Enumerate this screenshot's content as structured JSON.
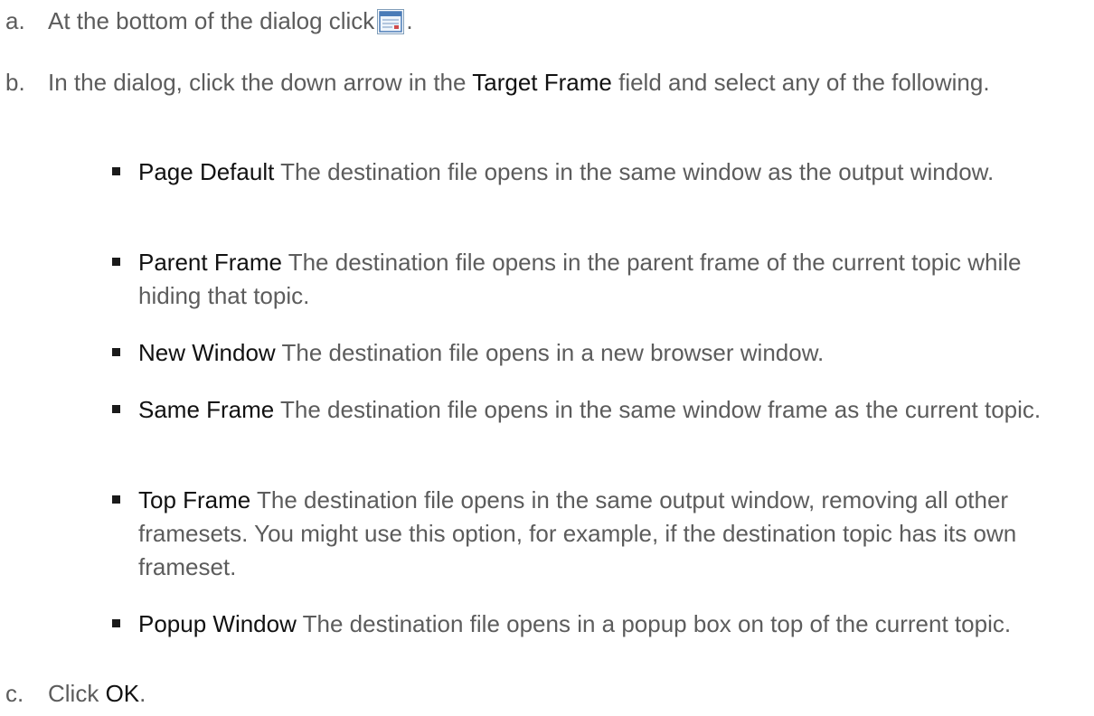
{
  "steps": [
    {
      "marker": "a.",
      "before": "At the bottom of the dialog click",
      "icon": "dialog-window-icon",
      "after": "."
    },
    {
      "marker": "b.",
      "before": "In the dialog, click the down arrow in the",
      "term": "Target Frame",
      "after": "field and select any of the following."
    },
    {
      "marker": "c.",
      "before": "Click",
      "term": "OK",
      "after": "."
    }
  ],
  "options": [
    {
      "term": "Page Default",
      "desc": "The destination file opens in the same window as the output window."
    },
    {
      "term": "Parent Frame",
      "desc": "The destination file opens in the parent frame of the current topic while hiding that topic."
    },
    {
      "term": "New Window",
      "desc": "The destination file opens in a new browser window."
    },
    {
      "term": "Same Frame",
      "desc": "The destination file opens in the same window frame as the current topic."
    },
    {
      "term": "Top Frame",
      "desc": "The destination file opens in the same output window, removing all other framesets. You might use this option, for example, if the destination topic has its own frameset."
    },
    {
      "term": "Popup Window",
      "desc": "The destination file opens in a popup box on top of the current topic."
    }
  ],
  "colors": {
    "body_text": "#5c5c5c",
    "term_text": "#111111",
    "bullet": "#1a1a1a",
    "icon_border": "#7f9db9"
  }
}
